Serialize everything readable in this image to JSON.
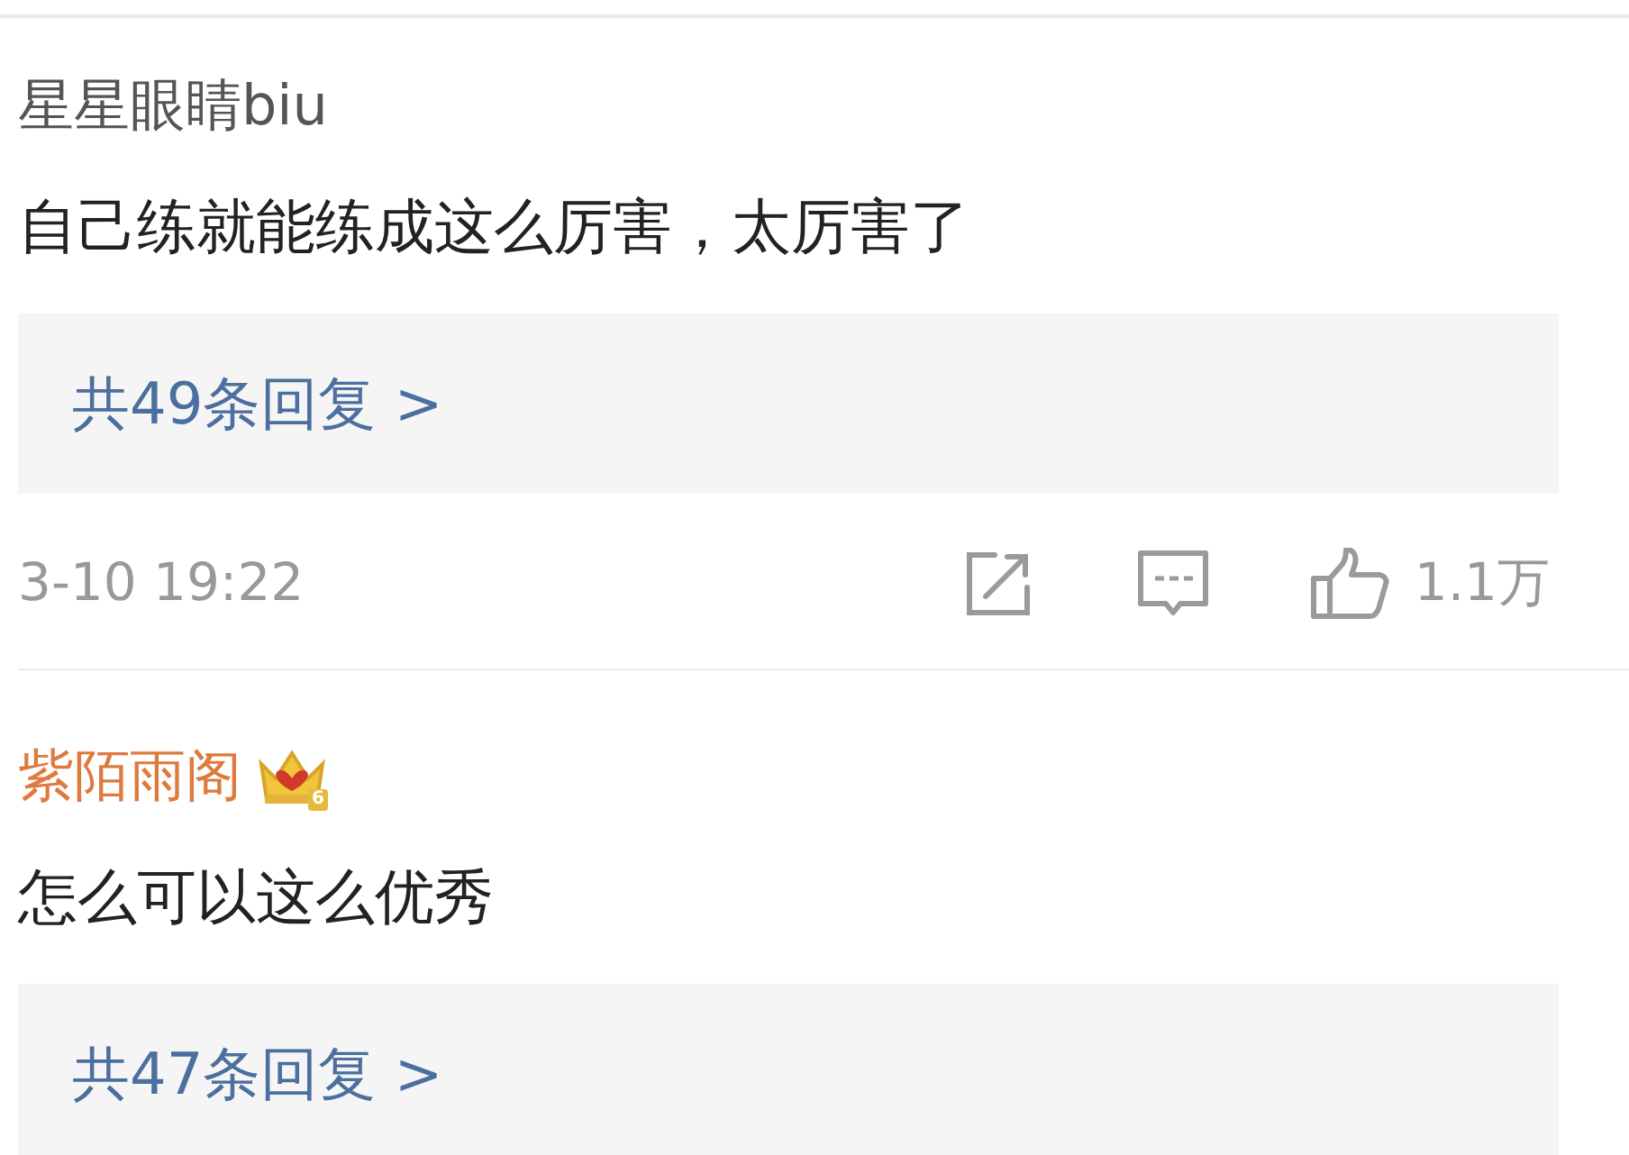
{
  "comments": [
    {
      "user": {
        "name": "星星眼睛biu",
        "vip": false
      },
      "text": "自己练就能练成这么厉害，太厉害了",
      "replies": "共49条回复 >",
      "meta": {
        "time": "3-10 19:22",
        "likes": "1.1万"
      }
    },
    {
      "user": {
        "name": "紫陌雨阁",
        "vip": true,
        "vip_level": "6"
      },
      "text": "怎么可以这么优秀",
      "replies": "共47条回复 >"
    }
  ]
}
